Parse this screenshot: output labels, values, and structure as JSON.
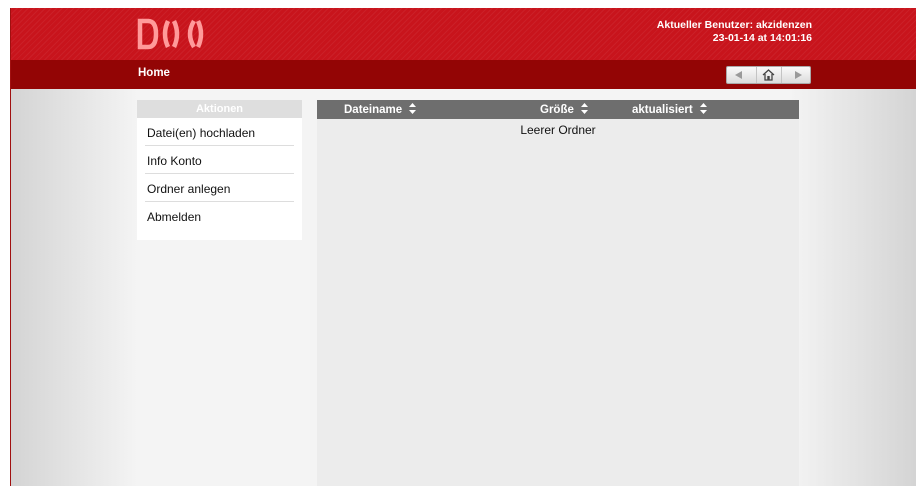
{
  "header": {
    "user_line": "Aktueller Benutzer: akzidenzen",
    "datetime_line": "23-01-14 at 14:01:16",
    "brand_color": "#c8141c"
  },
  "navbar": {
    "breadcrumb": "Home",
    "color": "#930505"
  },
  "sidebar": {
    "title": "Aktionen",
    "items": [
      {
        "label": "Datei(en) hochladen"
      },
      {
        "label": "Info Konto"
      },
      {
        "label": "Ordner anlegen"
      },
      {
        "label": "Abmelden"
      }
    ]
  },
  "file_table": {
    "columns": [
      {
        "label": "Dateiname"
      },
      {
        "label": "Größe"
      },
      {
        "label": "aktualisiert"
      }
    ],
    "empty_message": "Leerer Ordner"
  },
  "icons": {
    "nav_back": "back-arrow-icon",
    "nav_home": "home-icon",
    "nav_forward": "forward-arrow-icon",
    "sort": "sort-updown-icon"
  }
}
